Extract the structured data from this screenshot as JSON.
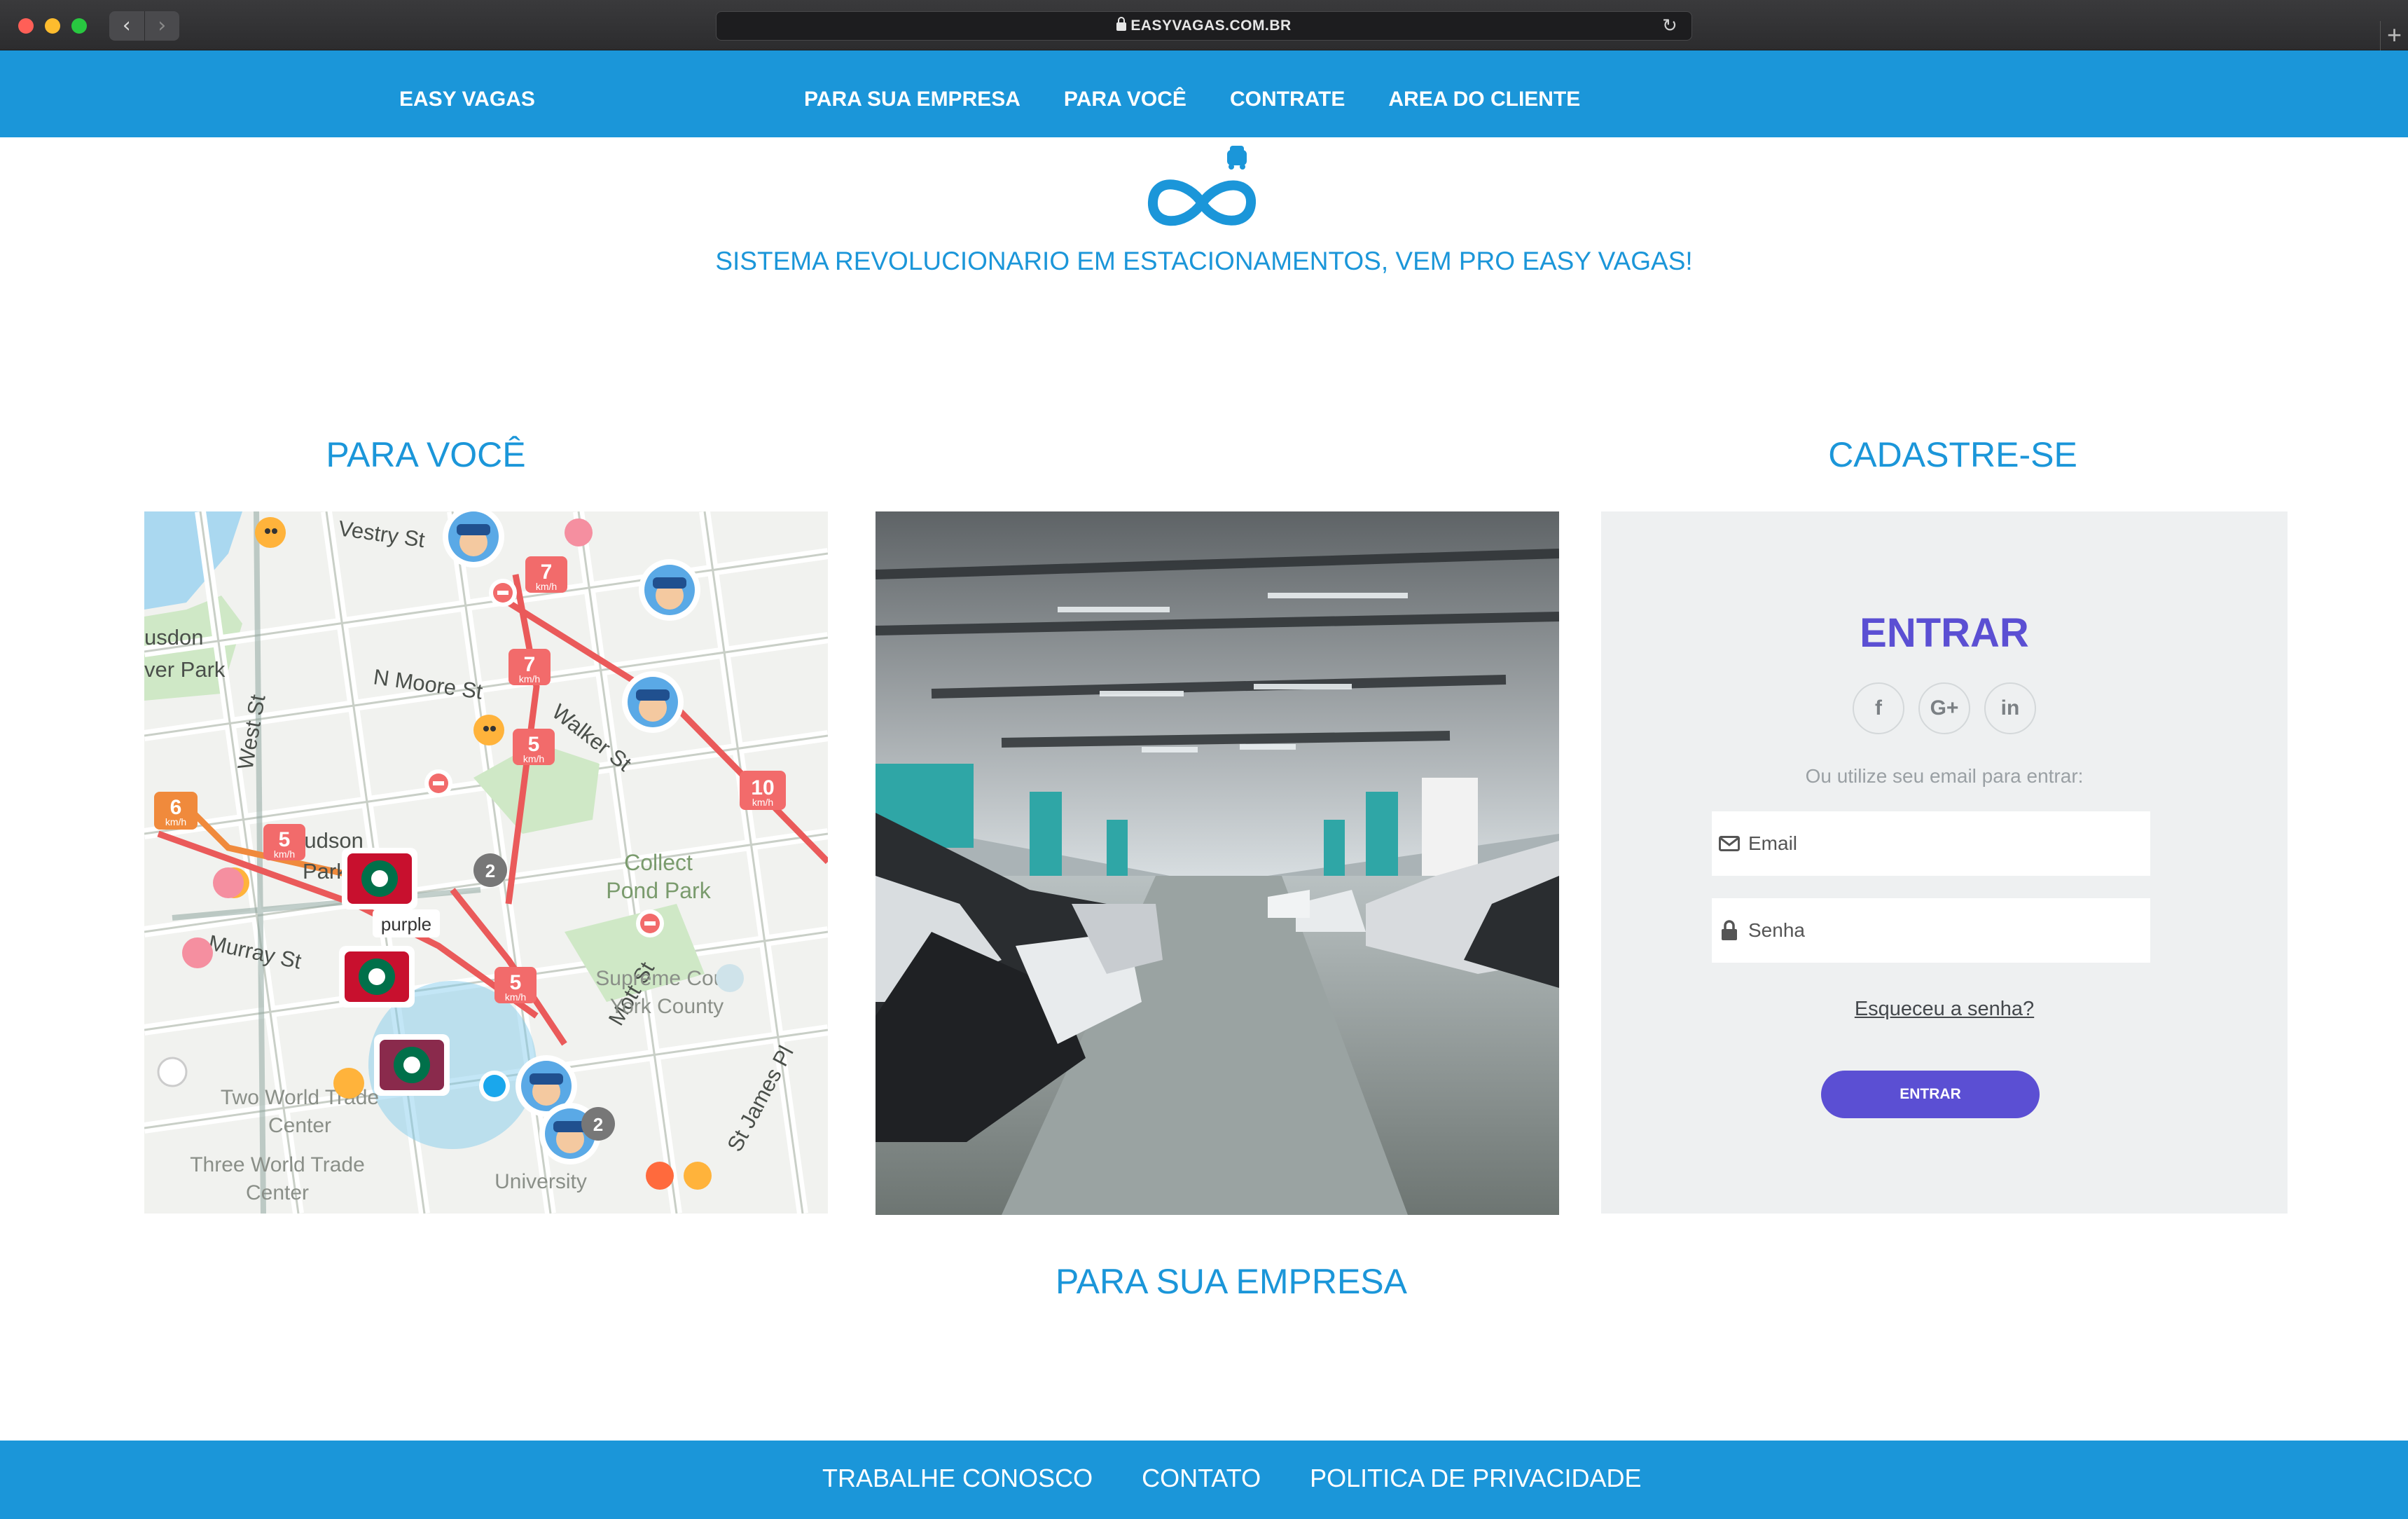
{
  "browser": {
    "url": "EASYVAGAS.COM.BR",
    "back_glyph": "‹",
    "forward_glyph": "›",
    "reload_glyph": "↻",
    "new_tab_glyph": "+"
  },
  "header": {
    "brand": "EASY VAGAS",
    "nav": [
      "PARA SUA EMPRESA",
      "PARA VOCÊ",
      "CONTRATE",
      "AREA DO CLIENTE"
    ]
  },
  "hero": {
    "tagline": "SISTEMA REVOLUCIONARIO EM ESTACIONAMENTOS, VEM PRO EASY VAGAS!"
  },
  "sections": {
    "para_voce": "PARA VOCÊ",
    "cadastre": "CADASTRE-SE",
    "para_empresa": "PARA SUA EMPRESA"
  },
  "map": {
    "labels": [
      "Vestry St",
      "N Moore St",
      "Walker St",
      "West St",
      "Murray St",
      "Collect",
      "Pond Park",
      "Supreme Court",
      "York County",
      "Two World Trade",
      "Center",
      "Three World Trade",
      "Center",
      "Mott St",
      "St James Pl",
      "usdon",
      "ver Park",
      "Hudson",
      "Park",
      "University",
      "purple"
    ],
    "speed_badges": [
      {
        "value": "7",
        "unit": "km/h"
      },
      {
        "value": "7",
        "unit": "km/h"
      },
      {
        "value": "5",
        "unit": "km/h"
      },
      {
        "value": "10",
        "unit": "km/h"
      },
      {
        "value": "6",
        "unit": "km/h"
      },
      {
        "value": "5",
        "unit": "km/h"
      },
      {
        "value": "5",
        "unit": "km/h"
      }
    ],
    "counts": [
      "2",
      "2"
    ]
  },
  "login": {
    "title": "ENTRAR",
    "social": [
      "f",
      "G+",
      "in"
    ],
    "subtitle": "Ou utilize seu email para entrar:",
    "email_placeholder": "Email",
    "password_placeholder": "Senha",
    "forgot": "Esqueceu a senha?",
    "button": "ENTRAR"
  },
  "footer": {
    "links": [
      "TRABALHE CONOSCO",
      "CONTATO",
      "POLITICA DE PRIVACIDADE"
    ]
  },
  "colors": {
    "brand_blue": "#1b96d9",
    "accent_purple": "#5b4fd3",
    "panel_bg": "#eef0f1"
  }
}
